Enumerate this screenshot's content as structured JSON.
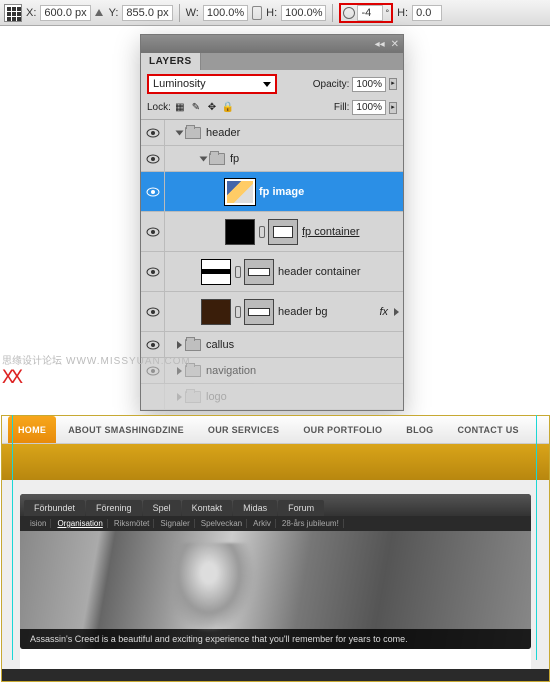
{
  "options_bar": {
    "x_label": "X:",
    "x_value": "600.0 px",
    "y_label": "Y:",
    "y_value": "855.0 px",
    "w_label": "W:",
    "w_value": "100.0%",
    "h_label": "H:",
    "h_value": "100.0%",
    "angle_value": "-4",
    "h2_label": "H:",
    "h2_value": "0.0"
  },
  "layers_panel": {
    "tab": "LAYERS",
    "blend_mode": "Luminosity",
    "opacity_label": "Opacity:",
    "opacity_value": "100%",
    "lock_label": "Lock:",
    "fill_label": "Fill:",
    "fill_value": "100%",
    "items": [
      {
        "name": "header"
      },
      {
        "name": "fp"
      },
      {
        "name": "fp image"
      },
      {
        "name": "fp container"
      },
      {
        "name": "header container"
      },
      {
        "name": "header bg",
        "fx": "fx"
      },
      {
        "name": "callus"
      },
      {
        "name": "navigation"
      },
      {
        "name": "logo"
      }
    ]
  },
  "watermark": {
    "text": "思缘设计论坛",
    "url": "WWW.MISSYUAN.COM",
    "xx": "XX"
  },
  "site": {
    "nav": [
      "HOME",
      "ABOUT SMASHINGDZINE",
      "OUR SERVICES",
      "OUR PORTFOLIO",
      "BLOG",
      "CONTACT US"
    ],
    "hero_tabs": [
      "Förbundet",
      "Förening",
      "Spel",
      "Kontakt",
      "Midas",
      "Forum"
    ],
    "hero_sub": [
      "ision",
      "Organisation",
      "Riksmötet",
      "Signaler",
      "Spelveckan",
      "Arkiv",
      "28-års jubileum!"
    ],
    "hero_caption": "Assassin's Creed is a beautiful and exciting experience that you'll remember for years to come.",
    "hero_footer": ""
  }
}
